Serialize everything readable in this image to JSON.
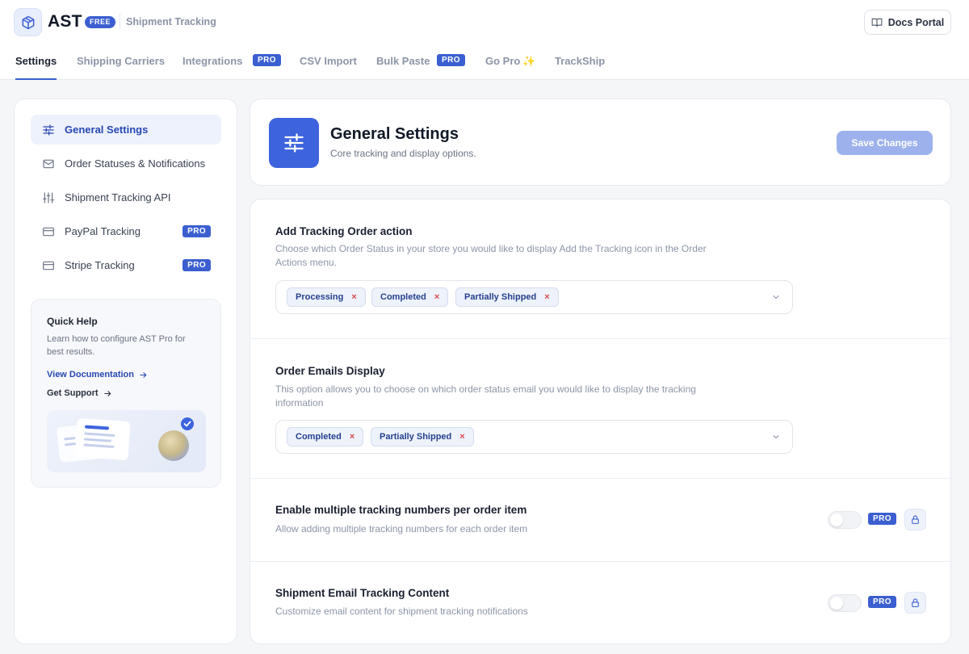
{
  "header": {
    "brand": "AST",
    "badge": "FREE",
    "subtitle": "Shipment Tracking",
    "docs_button": "Docs Portal"
  },
  "tabs": [
    {
      "label": "Settings",
      "active": true
    },
    {
      "label": "Shipping Carriers"
    },
    {
      "label": "Integrations",
      "badge": "PRO"
    },
    {
      "label": "CSV Import"
    },
    {
      "label": "Bulk Paste",
      "badge": "PRO"
    },
    {
      "label": "Go Pro",
      "icon": "sparkle-icon"
    },
    {
      "label": "TrackShip"
    }
  ],
  "sidebar": {
    "items": [
      {
        "label": "General Settings",
        "icon": "sliders-icon",
        "active": true
      },
      {
        "label": "Order Statuses & Notifications",
        "icon": "mail-icon"
      },
      {
        "label": "Shipment Tracking API",
        "icon": "equalizer-icon"
      },
      {
        "label": "PayPal Tracking",
        "icon": "card-icon",
        "badge": "PRO"
      },
      {
        "label": "Stripe Tracking",
        "icon": "card-icon",
        "badge": "PRO"
      }
    ],
    "quick_help": {
      "title": "Quick Help",
      "description": "Learn how to configure AST Pro for best results.",
      "doc_link": "View Documentation",
      "support_link": "Get Support"
    }
  },
  "main": {
    "title": "General Settings",
    "subtitle": "Core tracking and display options.",
    "save_button": "Save Changes"
  },
  "settings": {
    "add_tracking": {
      "title": "Add Tracking Order action",
      "description": "Choose which Order Status in your store you would like to display Add the Tracking icon in the Order Actions menu.",
      "chips": [
        "Processing",
        "Completed",
        "Partially Shipped"
      ]
    },
    "order_emails": {
      "title": "Order Emails Display",
      "description": "This option allows you to choose on which order status email you would like to display the tracking information",
      "chips": [
        "Completed",
        "Partially Shipped"
      ]
    },
    "multiple_tracking": {
      "title": "Enable multiple tracking numbers per order item",
      "description": "Allow adding multiple tracking numbers for each order item",
      "badge": "PRO",
      "enabled": false
    },
    "email_content": {
      "title": "Shipment Email Tracking Content",
      "description": "Customize email content for shipment tracking notifications",
      "badge": "PRO",
      "enabled": false
    }
  },
  "colors": {
    "accent": "#3b5fd0",
    "accent_light": "#eef2fd",
    "remove_x": "#d94848",
    "save_disabled": "#9db2ec"
  }
}
